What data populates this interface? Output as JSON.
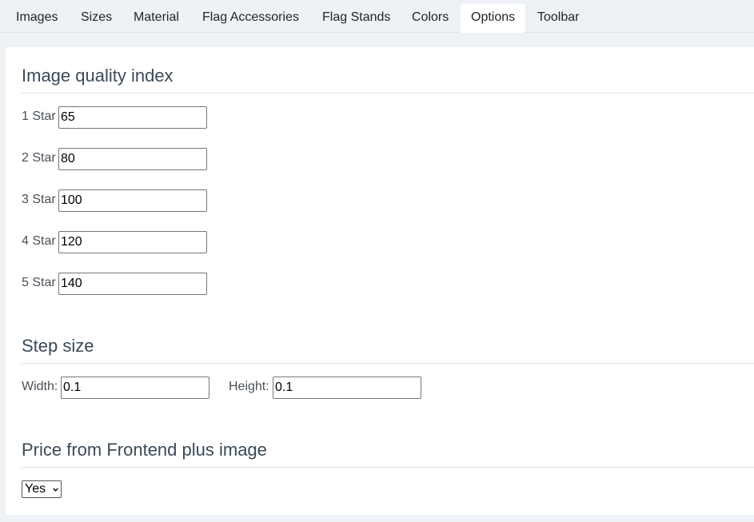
{
  "tabs": [
    {
      "label": "Images"
    },
    {
      "label": "Sizes"
    },
    {
      "label": "Material"
    },
    {
      "label": "Flag Accessories"
    },
    {
      "label": "Flag Stands"
    },
    {
      "label": "Colors"
    },
    {
      "label": "Options",
      "active": true
    },
    {
      "label": "Toolbar"
    }
  ],
  "quality": {
    "title": "Image quality index",
    "rows": [
      {
        "label": "1 Star",
        "value": "65"
      },
      {
        "label": "2 Star",
        "value": "80"
      },
      {
        "label": "3 Star",
        "value": "100"
      },
      {
        "label": "4 Star",
        "value": "120"
      },
      {
        "label": "5 Star",
        "value": "140"
      }
    ]
  },
  "step": {
    "title": "Step size",
    "width_label": "Width:",
    "width_value": "0.1",
    "height_label": "Height:",
    "height_value": "0.1"
  },
  "price": {
    "title": "Price from Frontend plus image",
    "selected": "Yes"
  },
  "icons": {
    "dropdown": "chevron-down-icon"
  }
}
